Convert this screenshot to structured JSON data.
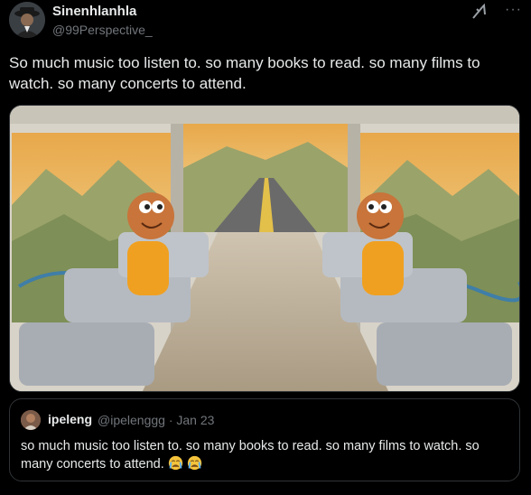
{
  "post": {
    "display_name": "Sinenhlanhla",
    "handle": "@99Perspective_",
    "text": "So much music too listen to. so many books to read. so many films to watch. so many concerts to attend.",
    "grok_icon": "grok-icon",
    "more_icon": "more-icon"
  },
  "media": {
    "alt": "Cartoon of a boy riding a bus, looking happily out of both windows at mountain scenery"
  },
  "quote": {
    "display_name": "ipeleng",
    "handle": "@ipelenggg",
    "separator": "·",
    "date": "Jan 23",
    "text": "so much music too listen to. so many books to read. so many films to watch. so many concerts to attend.",
    "emojis": [
      "crying-face",
      "crying-face"
    ]
  },
  "colors": {
    "background": "#000000",
    "text": "#e7e9ea",
    "muted": "#71767b",
    "border": "#2f3336"
  }
}
